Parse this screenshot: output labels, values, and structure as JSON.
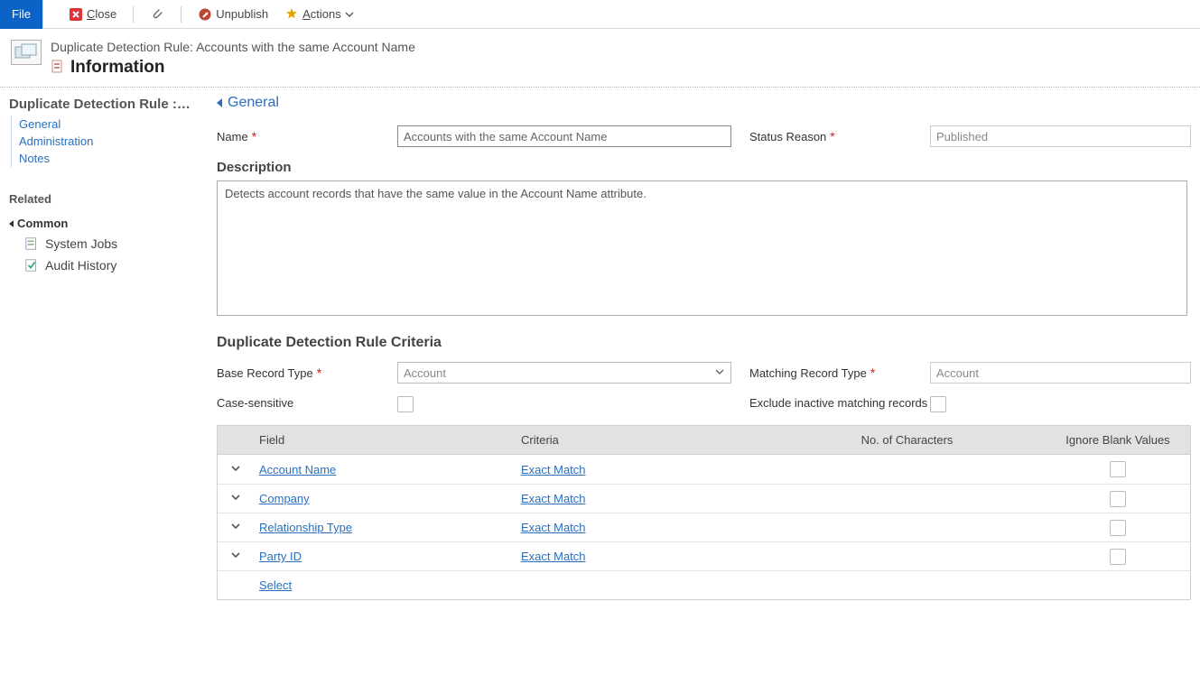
{
  "toolbar": {
    "file": "File",
    "close_u": "C",
    "close_rest": "lose",
    "unpublish": "Unpublish",
    "actions_pre": "",
    "actions_u": "A",
    "actions_rest": "ctions"
  },
  "header": {
    "sub_prefix": "Duplicate Detection Rule: ",
    "sub_name": "Accounts with the same Account Name",
    "title": "Information"
  },
  "sidebar": {
    "title": "Duplicate Detection Rule :…",
    "tree": [
      "General",
      "Administration",
      "Notes"
    ],
    "related_label": "Related",
    "common_label": "Common",
    "links": [
      "System Jobs",
      "Audit History"
    ]
  },
  "section": {
    "general": "General",
    "name_label": "Name",
    "name_value": "Accounts with the same Account Name",
    "status_label": "Status Reason",
    "status_value": "Published",
    "desc_label": "Description",
    "desc_value": "Detects account records that have the same value in the Account Name attribute.",
    "criteria_head": "Duplicate Detection Rule Criteria",
    "base_type_label": "Base Record Type",
    "base_type_value": "Account",
    "match_type_label": "Matching Record Type",
    "match_type_value": "Account",
    "case_label": "Case-sensitive",
    "exclude_label": "Exclude inactive matching records"
  },
  "grid": {
    "headers": {
      "field": "Field",
      "criteria": "Criteria",
      "chars": "No. of Characters",
      "ignore": "Ignore Blank Values"
    },
    "rows": [
      {
        "field": "Account Name",
        "criteria": "Exact Match"
      },
      {
        "field": "Company",
        "criteria": "Exact Match"
      },
      {
        "field": "Relationship Type",
        "criteria": "Exact Match"
      },
      {
        "field": "Party ID",
        "criteria": "Exact Match"
      }
    ],
    "select_label": "Select"
  }
}
